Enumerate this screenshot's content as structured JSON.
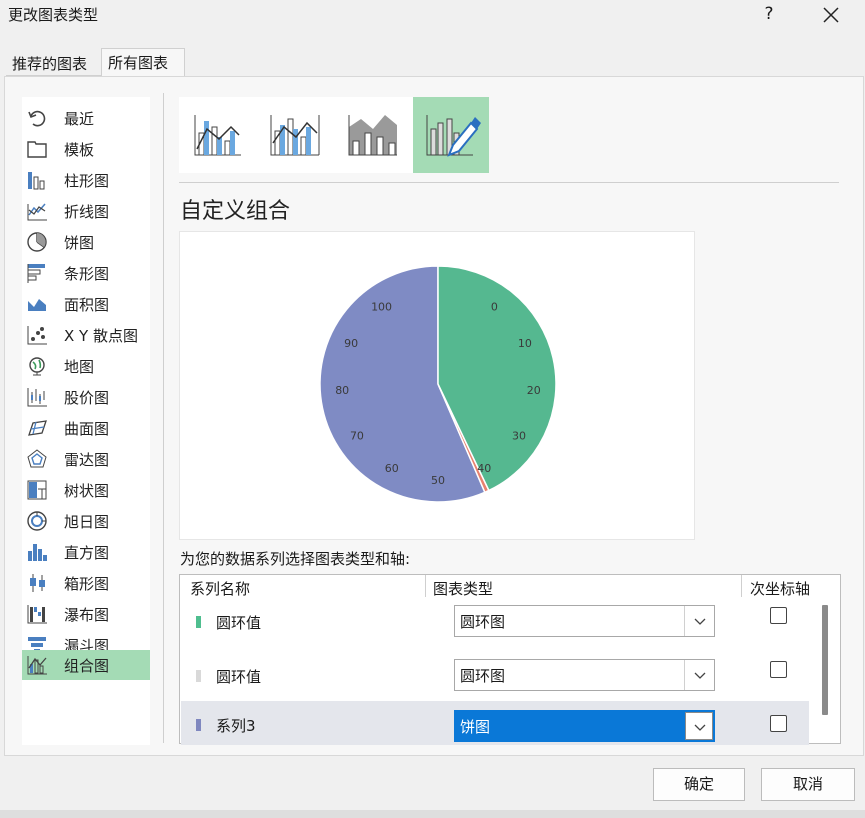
{
  "dialog": {
    "title": "更改图表类型",
    "help": "?"
  },
  "tabs": [
    {
      "label": "推荐的图表"
    },
    {
      "label": "所有图表"
    }
  ],
  "chart_types": [
    {
      "label": "最近",
      "icon": "recent-icon"
    },
    {
      "label": "模板",
      "icon": "template-icon"
    },
    {
      "label": "柱形图",
      "icon": "column-chart-icon"
    },
    {
      "label": "折线图",
      "icon": "line-chart-icon"
    },
    {
      "label": "饼图",
      "icon": "pie-chart-icon"
    },
    {
      "label": "条形图",
      "icon": "bar-chart-icon"
    },
    {
      "label": "面积图",
      "icon": "area-chart-icon"
    },
    {
      "label": "X Y 散点图",
      "icon": "scatter-chart-icon"
    },
    {
      "label": "地图",
      "icon": "map-chart-icon"
    },
    {
      "label": "股价图",
      "icon": "stock-chart-icon"
    },
    {
      "label": "曲面图",
      "icon": "surface-chart-icon"
    },
    {
      "label": "雷达图",
      "icon": "radar-chart-icon"
    },
    {
      "label": "树状图",
      "icon": "treemap-chart-icon"
    },
    {
      "label": "旭日图",
      "icon": "sunburst-chart-icon"
    },
    {
      "label": "直方图",
      "icon": "histogram-chart-icon"
    },
    {
      "label": "箱形图",
      "icon": "box-whisker-chart-icon"
    },
    {
      "label": "瀑布图",
      "icon": "waterfall-chart-icon"
    },
    {
      "label": "漏斗图",
      "icon": "funnel-chart-icon"
    },
    {
      "label": "组合图",
      "icon": "combo-chart-icon",
      "selected": true
    }
  ],
  "combo_subtypes": [
    {
      "icon": "clustered-column-line-icon"
    },
    {
      "icon": "clustered-column-line-secondary-axis-icon"
    },
    {
      "icon": "stacked-area-clustered-column-icon"
    },
    {
      "icon": "custom-combination-icon",
      "selected": true
    }
  ],
  "main": {
    "combo_title": "自定义组合",
    "series_prompt": "为您的数据系列选择图表类型和轴:"
  },
  "series_table": {
    "headers": {
      "name": "系列名称",
      "type": "图表类型",
      "secondary": "次坐标轴"
    },
    "rows": [
      {
        "name": "圆环值",
        "type": "圆环图",
        "secondary": false,
        "color": "#4fbe8f",
        "selected": false
      },
      {
        "name": "圆环值",
        "type": "圆环图",
        "secondary": false,
        "color": "#d9d9d9",
        "selected": false
      },
      {
        "name": "系列3",
        "type": "饼图",
        "secondary": false,
        "color": "#7f87bf",
        "selected": true
      }
    ]
  },
  "chart_data": {
    "type": "pie",
    "series": [
      {
        "name": "系列3",
        "values": [
          56.5,
          0.6,
          42.9
        ],
        "colors": [
          "#7f8bc4",
          "#e8826f",
          "#55b890"
        ]
      }
    ],
    "tick_labels": [
      "0",
      "10",
      "20",
      "30",
      "40",
      "50",
      "60",
      "70",
      "80",
      "90",
      "100"
    ]
  },
  "buttons": {
    "ok": "确定",
    "cancel": "取消"
  }
}
